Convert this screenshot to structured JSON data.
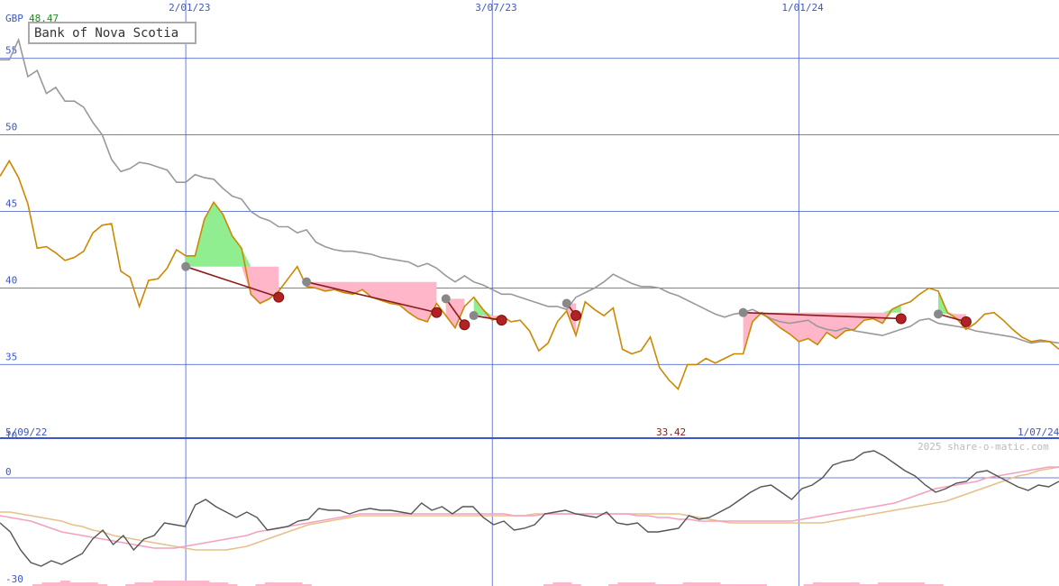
{
  "chart_data": [
    {
      "type": "line",
      "title": "Bank of Nova Scotia",
      "currency": "GBP",
      "last_price": "48.47",
      "period_start": "5/09/22",
      "period_end": "1/07/24",
      "period_low": "33.42",
      "watermark": "2025 share-o-matic.com",
      "ylim": [
        30.2,
        58.8
      ],
      "y_ticks": [
        {
          "label": "55",
          "value": 55
        },
        {
          "label": "50",
          "value": 50
        },
        {
          "label": "45",
          "value": 45
        },
        {
          "label": "40",
          "value": 40
        },
        {
          "label": "35",
          "value": 35
        }
      ],
      "x_ticks": [
        {
          "label": "2/01/23",
          "index": 20
        },
        {
          "label": "3/07/23",
          "index": 53
        },
        {
          "label": "1/01/24",
          "index": 86
        }
      ],
      "colors": {
        "price": "#cc8800",
        "trend": "#999999",
        "grid": "#3d56c9",
        "signal": "#8b1a1a",
        "gain": "#90ee90",
        "loss": "#ffb6c8"
      },
      "series": [
        {
          "key": "price",
          "values": [
            47.3,
            48.3,
            47.2,
            45.5,
            42.6,
            42.7,
            42.3,
            41.8,
            42.0,
            42.4,
            43.6,
            44.1,
            44.2,
            41.1,
            40.7,
            38.8,
            40.5,
            40.6,
            41.3,
            42.5,
            42.1,
            42.1,
            44.5,
            45.6,
            44.8,
            43.4,
            42.6,
            39.6,
            39.0,
            39.3,
            39.8,
            40.6,
            41.4,
            40.1,
            40.0,
            39.8,
            39.9,
            39.7,
            39.6,
            39.9,
            39.4,
            39.2,
            39.0,
            38.9,
            38.4,
            38.0,
            37.8,
            39.0,
            38.2,
            37.4,
            38.8,
            39.4,
            38.6,
            37.9,
            38.2,
            37.8,
            37.9,
            37.2,
            35.9,
            36.4,
            37.8,
            38.5,
            36.9,
            39.1,
            38.6,
            38.2,
            38.7,
            36.0,
            35.7,
            35.9,
            36.8,
            34.8,
            34.0,
            33.4,
            35.0,
            35.0,
            35.4,
            35.1,
            35.4,
            35.7,
            35.7,
            37.8,
            38.4,
            37.9,
            37.4,
            37.0,
            36.5,
            36.7,
            36.3,
            37.1,
            36.7,
            37.2,
            37.3,
            37.9,
            38.0,
            37.7,
            38.6,
            38.9,
            39.1,
            39.6,
            40.0,
            39.8,
            38.4,
            38.0,
            37.3,
            37.7,
            38.3,
            38.4,
            37.9,
            37.3,
            36.8,
            36.5,
            36.6,
            36.5,
            36.0
          ]
        },
        {
          "key": "trend",
          "values": [
            54.9,
            54.9,
            56.2,
            53.8,
            54.2,
            52.7,
            53.1,
            52.2,
            52.2,
            51.8,
            50.8,
            50.0,
            48.4,
            47.6,
            47.8,
            48.2,
            48.1,
            47.9,
            47.7,
            46.9,
            46.9,
            47.4,
            47.2,
            47.1,
            46.5,
            46.0,
            45.8,
            45.0,
            44.6,
            44.4,
            44.0,
            44.0,
            43.6,
            43.8,
            43.0,
            42.7,
            42.5,
            42.4,
            42.4,
            42.3,
            42.2,
            42.0,
            41.9,
            41.8,
            41.7,
            41.4,
            41.6,
            41.3,
            40.8,
            40.4,
            40.8,
            40.4,
            40.2,
            39.9,
            39.6,
            39.6,
            39.4,
            39.2,
            39.0,
            38.8,
            38.8,
            38.6,
            39.4,
            39.7,
            40.0,
            40.4,
            40.9,
            40.6,
            40.3,
            40.1,
            40.1,
            40.0,
            39.7,
            39.5,
            39.2,
            38.9,
            38.6,
            38.3,
            38.1,
            38.3,
            38.4,
            38.6,
            38.3,
            38.0,
            37.8,
            37.7,
            37.8,
            37.9,
            37.5,
            37.3,
            37.2,
            37.4,
            37.2,
            37.1,
            37.0,
            36.9,
            37.1,
            37.3,
            37.5,
            37.9,
            38.0,
            37.7,
            37.6,
            37.5,
            37.4,
            37.2,
            37.1,
            37.0,
            36.9,
            36.8,
            36.6,
            36.4,
            36.5,
            36.5,
            36.4
          ]
        }
      ],
      "signals": [
        {
          "from_index": 20,
          "from_value": 41.4,
          "to_index": 30,
          "to_value": 39.4
        },
        {
          "from_index": 33,
          "from_value": 40.4,
          "to_index": 47,
          "to_value": 38.4
        },
        {
          "from_index": 48,
          "from_value": 39.3,
          "to_index": 50,
          "to_value": 37.6
        },
        {
          "from_index": 51,
          "from_value": 38.2,
          "to_index": 54,
          "to_value": 37.9
        },
        {
          "from_index": 61,
          "from_value": 39.0,
          "to_index": 62,
          "to_value": 38.2
        },
        {
          "from_index": 80,
          "from_value": 38.4,
          "to_index": 97,
          "to_value": 38.0
        },
        {
          "from_index": 101,
          "from_value": 38.3,
          "to_index": 104,
          "to_value": 37.8
        }
      ]
    },
    {
      "type": "line",
      "ylim": [
        -30,
        11
      ],
      "y_ticks": [
        {
          "label": "10",
          "value": 10
        },
        {
          "label": "0",
          "value": 0
        },
        {
          "label": "-30",
          "value": -30
        }
      ],
      "colors": {
        "oscillator": "#555555",
        "fast_average": "#f4a0c0",
        "slow_average": "#e6c08c",
        "volume": "#ffb6c8"
      },
      "series": [
        {
          "key": "oscillator",
          "values": [
            -12.5,
            -15.0,
            -20.0,
            -23.5,
            -24.5,
            -23.0,
            -24.0,
            -22.5,
            -21.0,
            -17.0,
            -14.5,
            -18.5,
            -16.0,
            -20.0,
            -17.0,
            -16.0,
            -12.5,
            -13.0,
            -13.5,
            -7.5,
            -6.0,
            -8.0,
            -9.5,
            -11.0,
            -9.5,
            -11.0,
            -14.5,
            -14.0,
            -13.5,
            -12.0,
            -11.5,
            -8.5,
            -9.0,
            -9.0,
            -10.0,
            -9.0,
            -8.5,
            -9.0,
            -9.0,
            -9.5,
            -10.0,
            -7.0,
            -9.0,
            -8.0,
            -10.0,
            -8.0,
            -8.0,
            -11.0,
            -13.0,
            -12.0,
            -14.5,
            -14.0,
            -13.0,
            -10.0,
            -9.5,
            -9.0,
            -10.0,
            -10.5,
            -11.0,
            -9.5,
            -12.5,
            -13.0,
            -12.5,
            -15.0,
            -15.0,
            -14.5,
            -14.0,
            -10.5,
            -11.5,
            -11.0,
            -9.5,
            -8.0,
            -6.0,
            -4.0,
            -2.5,
            -2.0,
            -4.0,
            -6.0,
            -3.0,
            -2.0,
            0.0,
            3.5,
            4.5,
            5.0,
            7.0,
            7.5,
            6.0,
            4.0,
            2.0,
            0.5,
            -2.0,
            -4.0,
            -3.0,
            -1.5,
            -1.0,
            1.5,
            2.0,
            0.5,
            -1.0,
            -2.5,
            -3.5,
            -2.0,
            -2.5,
            -1.0
          ]
        },
        {
          "key": "fast_average",
          "values": [
            -10.5,
            -11.0,
            -11.5,
            -12.0,
            -13.0,
            -14.0,
            -15.0,
            -15.5,
            -16.0,
            -16.5,
            -17.0,
            -17.5,
            -18.0,
            -18.5,
            -19.0,
            -19.5,
            -19.5,
            -19.5,
            -19.0,
            -18.5,
            -18.0,
            -17.5,
            -17.0,
            -16.5,
            -16.0,
            -15.0,
            -14.5,
            -14.0,
            -13.5,
            -13.0,
            -12.5,
            -12.0,
            -11.5,
            -11.0,
            -10.5,
            -10.0,
            -10.0,
            -10.0,
            -10.0,
            -10.0,
            -10.0,
            -10.0,
            -10.0,
            -10.0,
            -10.0,
            -10.0,
            -10.0,
            -10.0,
            -10.0,
            -10.0,
            -10.5,
            -10.5,
            -10.5,
            -10.0,
            -10.0,
            -10.0,
            -10.0,
            -10.0,
            -10.0,
            -10.0,
            -10.0,
            -10.0,
            -10.5,
            -10.5,
            -11.0,
            -11.0,
            -11.5,
            -11.5,
            -12.0,
            -12.0,
            -12.0,
            -12.0,
            -12.0,
            -12.0,
            -12.0,
            -12.0,
            -12.0,
            -12.0,
            -11.5,
            -11.0,
            -10.5,
            -10.0,
            -9.5,
            -9.0,
            -8.5,
            -8.0,
            -7.5,
            -7.0,
            -6.0,
            -5.0,
            -4.0,
            -3.0,
            -2.5,
            -2.0,
            -1.5,
            -1.0,
            0.0,
            0.5,
            1.0,
            1.5,
            2.0,
            2.5,
            3.0,
            3.0,
            3.0
          ]
        },
        {
          "key": "slow_average",
          "values": [
            -9.5,
            -9.5,
            -10.0,
            -10.5,
            -11.0,
            -11.5,
            -12.0,
            -13.0,
            -13.5,
            -14.5,
            -15.0,
            -16.0,
            -16.5,
            -17.0,
            -17.5,
            -18.0,
            -18.5,
            -19.0,
            -19.5,
            -20.0,
            -20.0,
            -20.0,
            -20.0,
            -19.5,
            -19.0,
            -18.0,
            -17.0,
            -16.0,
            -15.0,
            -14.0,
            -13.0,
            -12.5,
            -12.0,
            -11.5,
            -11.0,
            -10.5,
            -10.5,
            -10.5,
            -10.5,
            -10.5,
            -10.5,
            -10.5,
            -10.5,
            -10.5,
            -10.5,
            -10.5,
            -10.5,
            -10.5,
            -10.5,
            -10.5,
            -10.5,
            -10.5,
            -10.0,
            -10.0,
            -10.0,
            -10.0,
            -10.0,
            -10.0,
            -10.0,
            -10.0,
            -10.0,
            -10.0,
            -10.0,
            -10.0,
            -10.0,
            -10.0,
            -10.0,
            -10.5,
            -11.0,
            -11.5,
            -12.0,
            -12.5,
            -12.5,
            -12.5,
            -12.5,
            -12.5,
            -12.5,
            -12.5,
            -12.5,
            -12.5,
            -12.5,
            -12.0,
            -11.5,
            -11.0,
            -10.5,
            -10.0,
            -9.5,
            -9.0,
            -8.5,
            -8.0,
            -7.5,
            -7.0,
            -6.5,
            -5.5,
            -4.5,
            -3.5,
            -2.5,
            -1.5,
            -0.5,
            0.5,
            1.0,
            2.0,
            2.5,
            3.0,
            3.5
          ]
        },
        {
          "key": "volume",
          "values": [
            0,
            0,
            0,
            0,
            1,
            2,
            2,
            3,
            2,
            2,
            2,
            1,
            0,
            0,
            1,
            2,
            2,
            3,
            3,
            3,
            3,
            3,
            3,
            2,
            2,
            1,
            0,
            0,
            1,
            2,
            2,
            2,
            2,
            1,
            0,
            0,
            0,
            0,
            0,
            0,
            0,
            0,
            0,
            0,
            0,
            0,
            0,
            0,
            0,
            0,
            0,
            0,
            0,
            0,
            0,
            0,
            0,
            0,
            0,
            1,
            2,
            2,
            1,
            0,
            0,
            0,
            1,
            2,
            2,
            2,
            2,
            1,
            1,
            1,
            2,
            2,
            2,
            2,
            1,
            1,
            1,
            1,
            1,
            0,
            0,
            0,
            0,
            1,
            2,
            2,
            2,
            2,
            2,
            1,
            1,
            2,
            2,
            2,
            2,
            2,
            1,
            1,
            0,
            0,
            0
          ]
        }
      ]
    }
  ]
}
